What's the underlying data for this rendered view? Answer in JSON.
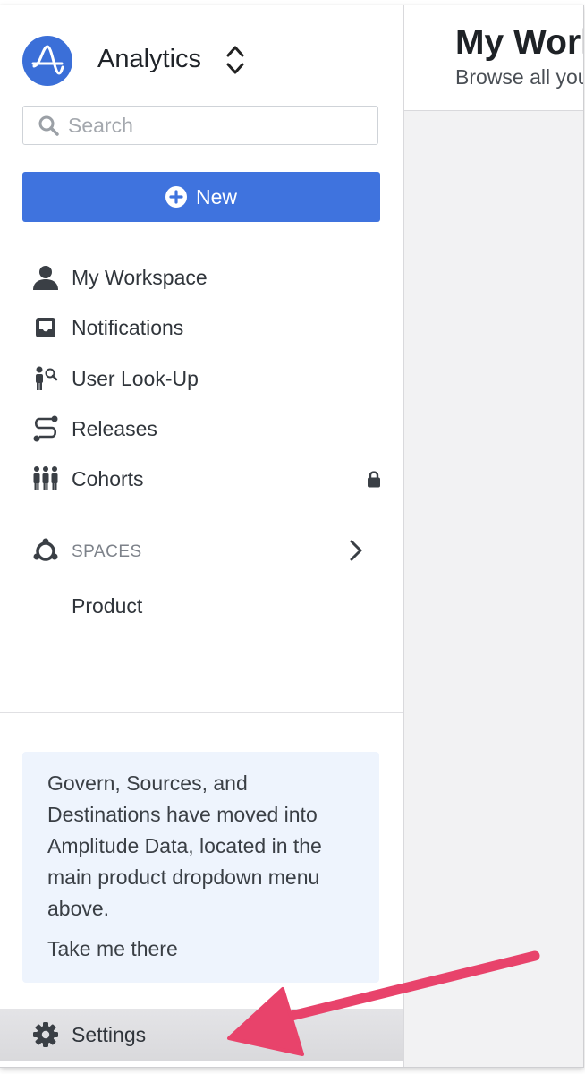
{
  "app": {
    "title": "Analytics"
  },
  "search": {
    "placeholder": "Search"
  },
  "new_button": {
    "label": "New"
  },
  "nav": {
    "items": [
      {
        "label": "My Workspace"
      },
      {
        "label": "Notifications"
      },
      {
        "label": "User Look-Up"
      },
      {
        "label": "Releases"
      },
      {
        "label": "Cohorts"
      }
    ]
  },
  "spaces": {
    "label": "SPACES",
    "items": [
      {
        "label": "Product"
      }
    ]
  },
  "notice": {
    "text": "Govern, Sources, and Destinations have moved into Amplitude Data, located in the main product dropdown menu above.",
    "link": "Take me there"
  },
  "settings": {
    "label": "Settings"
  },
  "main": {
    "title": "My Workspace",
    "subtitle": "Browse all your content"
  },
  "colors": {
    "accent": "#3f73de",
    "notice_bg": "#eef4fd",
    "annotation_arrow": "#e8436b"
  }
}
